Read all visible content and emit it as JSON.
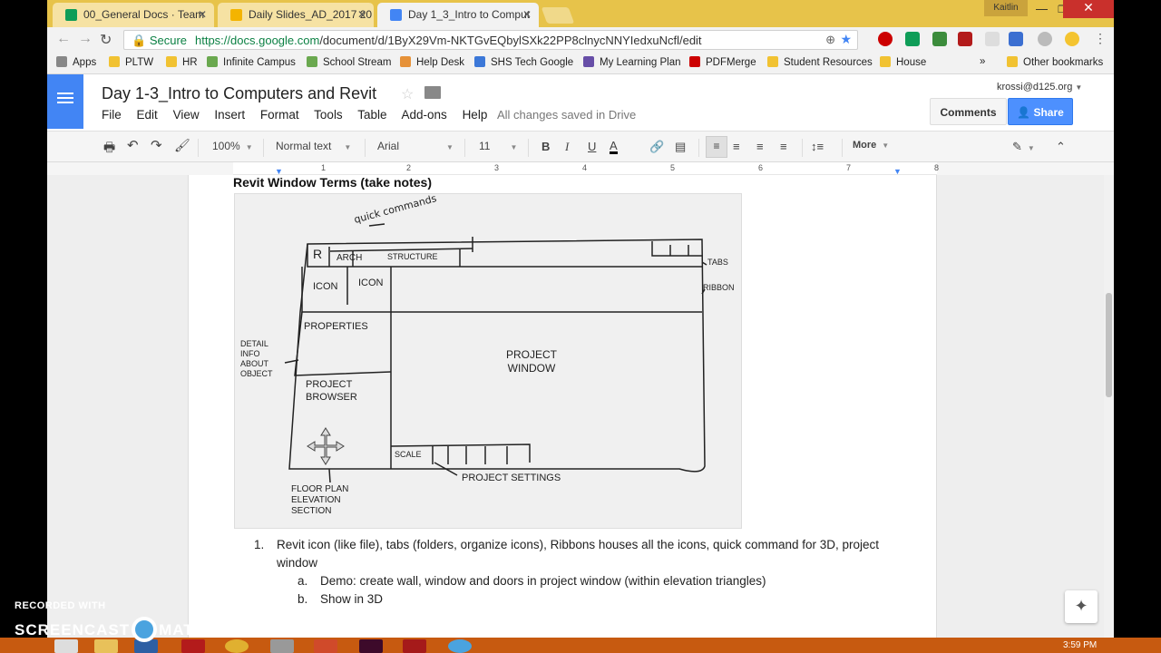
{
  "browser": {
    "tabs": [
      {
        "label": "00_General Docs · Team",
        "favicon_color": "#0f9d58"
      },
      {
        "label": "Daily Slides_AD_2017 20",
        "favicon_color": "#f4b400"
      },
      {
        "label": "Day 1_3_Intro to Comput",
        "favicon_color": "#4285f4"
      }
    ],
    "profile": "Kaitlin",
    "secure_label": "Secure",
    "url_scheme": "https://",
    "url_host": "docs.google.com",
    "url_path": "/document/d/1ByX29Vm-NKTGvEQbylSXk22PP8clnycNNYIedxuNcfl/edit",
    "bookmarks": [
      {
        "label": "Apps",
        "color": "#888888"
      },
      {
        "label": "PLTW",
        "color": "#f1c232"
      },
      {
        "label": "HR",
        "color": "#f1c232"
      },
      {
        "label": "Infinite Campus",
        "color": "#6aa84f"
      },
      {
        "label": "School Stream",
        "color": "#6aa84f"
      },
      {
        "label": "Help Desk",
        "color": "#e69138"
      },
      {
        "label": "SHS Tech Google",
        "color": "#3c78d8"
      },
      {
        "label": "My Learning Plan",
        "color": "#674ea7"
      },
      {
        "label": "PDFMerge",
        "color": "#cc0000"
      },
      {
        "label": "Student Resources",
        "color": "#f1c232"
      },
      {
        "label": "House",
        "color": "#f1c232"
      }
    ],
    "bookmarks_overflow": "»",
    "other_bookmarks": "Other bookmarks"
  },
  "docs": {
    "title": "Day 1-3_Intro to Computers and Revit",
    "menus": [
      "File",
      "Edit",
      "View",
      "Insert",
      "Format",
      "Tools",
      "Table",
      "Add-ons",
      "Help"
    ],
    "save_status": "All changes saved in Drive",
    "account": "krossi@d125.org",
    "comments_label": "Comments",
    "share_label": "Share"
  },
  "toolbar": {
    "zoom": "100%",
    "style": "Normal text",
    "font": "Arial",
    "size": "11",
    "bold": "B",
    "italic": "I",
    "underline": "U",
    "text_color": "A",
    "more": "More"
  },
  "ruler": {
    "ticks": [
      "1",
      "2",
      "3",
      "4",
      "5",
      "6",
      "7",
      "8"
    ]
  },
  "document": {
    "heading": "Revit Window Terms (take notes)",
    "sketch": {
      "labels": {
        "quick_commands": "quick commands",
        "r": "R",
        "arch": "ARCH",
        "structure": "STRUCTURE",
        "tabs": "TABS",
        "ribbon": "RIBBON",
        "icon1": "ICON",
        "icon2": "ICON",
        "properties": "PROPERTIES",
        "detail_info": "DETAIL INFO ABOUT OBJECT",
        "project_window": "PROJECT WINDOW",
        "project_browser": "PROJECT BROWSER",
        "scale": "SCALE",
        "project_settings": "PROJECT SETTINGS",
        "floor_plan": "FLOOR PLAN ELEVATION SECTION"
      }
    },
    "list": [
      {
        "num": "1.",
        "text": "Revit icon (like file), tabs (folders, organize icons), Ribbons houses all the icons, quick command for 3D, project window"
      },
      {
        "num": "a.",
        "text": "Demo: create wall, window and doors in project window (within elevation triangles)"
      },
      {
        "num": "b.",
        "text": "Show in 3D"
      }
    ]
  },
  "watermark": {
    "line1": "RECORDED WITH",
    "line2a": "SCREENCAST",
    "line2b": "MATIC"
  },
  "taskbar": {
    "clock": "3:59 PM"
  }
}
